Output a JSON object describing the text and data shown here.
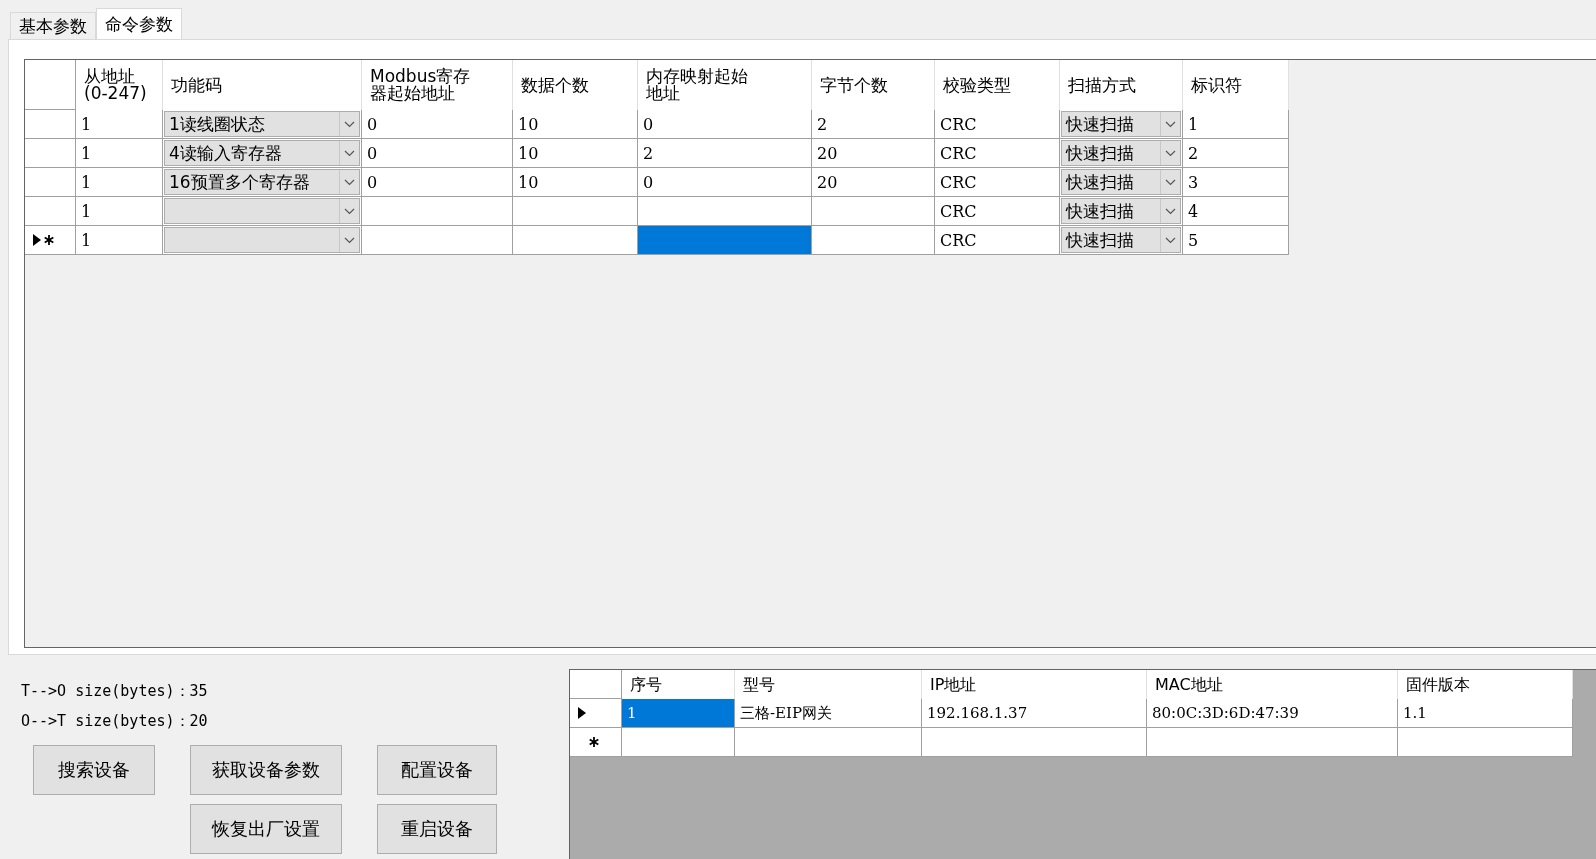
{
  "tabs": [
    {
      "label": "基本参数",
      "selected": false
    },
    {
      "label": "命令参数",
      "selected": true
    }
  ],
  "command_table": {
    "columns": [
      {
        "label": "从地址\n(0-247)",
        "kind": "text"
      },
      {
        "label": "功能码",
        "kind": "combo"
      },
      {
        "label": "Modbus寄存器起始地址",
        "kind": "text"
      },
      {
        "label": "数据个数",
        "kind": "text"
      },
      {
        "label": "内存映射起始地址",
        "kind": "text"
      },
      {
        "label": "字节个数",
        "kind": "text"
      },
      {
        "label": "校验类型",
        "kind": "text"
      },
      {
        "label": "扫描方式",
        "kind": "combo"
      },
      {
        "label": "标识符",
        "kind": "text"
      }
    ],
    "rows": [
      {
        "current": false,
        "new": false,
        "cells": [
          {
            "text": "1",
            "selected": false
          },
          {
            "text": "1读线圈状态",
            "selected": false
          },
          {
            "text": "0",
            "selected": false
          },
          {
            "text": "10",
            "selected": false
          },
          {
            "text": "0",
            "selected": false
          },
          {
            "text": "2",
            "selected": false
          },
          {
            "text": "CRC",
            "selected": false
          },
          {
            "text": "快速扫描",
            "selected": false
          },
          {
            "text": "1",
            "selected": false
          }
        ]
      },
      {
        "current": false,
        "new": false,
        "cells": [
          {
            "text": "1",
            "selected": false
          },
          {
            "text": "4读输入寄存器",
            "selected": false
          },
          {
            "text": "0",
            "selected": false
          },
          {
            "text": "10",
            "selected": false
          },
          {
            "text": "2",
            "selected": false
          },
          {
            "text": "20",
            "selected": false
          },
          {
            "text": "CRC",
            "selected": false
          },
          {
            "text": "快速扫描",
            "selected": false
          },
          {
            "text": "2",
            "selected": false
          }
        ]
      },
      {
        "current": false,
        "new": false,
        "cells": [
          {
            "text": "1",
            "selected": false
          },
          {
            "text": "16预置多个寄存器",
            "selected": false
          },
          {
            "text": "0",
            "selected": false
          },
          {
            "text": "10",
            "selected": false
          },
          {
            "text": "0",
            "selected": false
          },
          {
            "text": "20",
            "selected": false
          },
          {
            "text": "CRC",
            "selected": false
          },
          {
            "text": "快速扫描",
            "selected": false
          },
          {
            "text": "3",
            "selected": false
          }
        ]
      },
      {
        "current": false,
        "new": false,
        "cells": [
          {
            "text": "1",
            "selected": false
          },
          {
            "selected": false
          },
          {
            "selected": false
          },
          {
            "selected": false
          },
          {
            "selected": false
          },
          {
            "selected": false
          },
          {
            "text": "CRC",
            "selected": false
          },
          {
            "text": "快速扫描",
            "selected": false
          },
          {
            "text": "4",
            "selected": false
          }
        ]
      },
      {
        "current": true,
        "new": true,
        "cells": [
          {
            "text": "1",
            "selected": false
          },
          {
            "selected": false
          },
          {
            "selected": false
          },
          {
            "selected": false
          },
          {
            "selected": true
          },
          {
            "selected": false
          },
          {
            "text": "CRC",
            "selected": false
          },
          {
            "text": "快速扫描",
            "selected": false
          },
          {
            "text": "5",
            "selected": false
          }
        ]
      }
    ]
  },
  "size_labels": [
    "T-->O size(bytes)：35",
    "O-->T size(bytes)：20"
  ],
  "buttons": [
    [
      "搜索设备",
      "获取设备参数",
      "配置设备"
    ],
    [
      "恢复出厂设置",
      "重启设备"
    ]
  ],
  "device_table": {
    "columns": [
      "序号",
      "型号",
      "IP地址",
      "MAC地址",
      "固件版本"
    ],
    "rows": [
      {
        "current": true,
        "new": false,
        "cells": [
          {
            "text": "1",
            "selected": true
          },
          {
            "text": "三格-EIP网关",
            "selected": false
          },
          {
            "text": "192.168.1.37",
            "selected": false
          },
          {
            "text": "80:0C:3D:6D:47:39",
            "selected": false
          },
          {
            "text": "1.1",
            "selected": false
          }
        ]
      },
      {
        "current": false,
        "new": true,
        "cells": [
          {
            "selected": false
          },
          {
            "selected": false
          },
          {
            "selected": false
          },
          {
            "selected": false
          },
          {
            "selected": false
          }
        ]
      }
    ]
  }
}
